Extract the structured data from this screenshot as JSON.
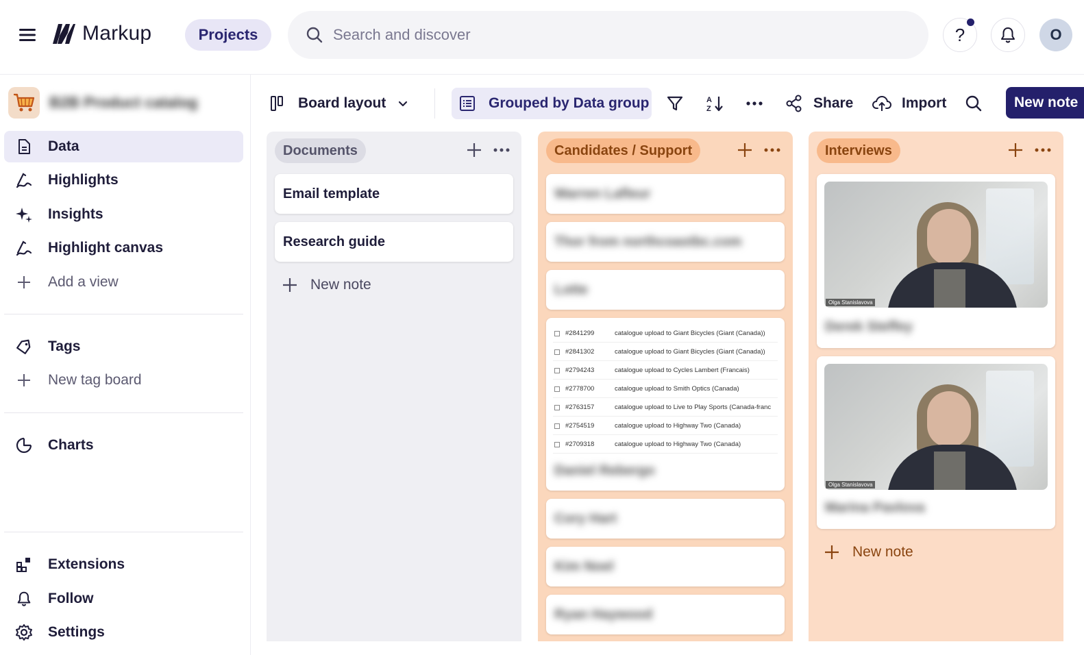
{
  "app": {
    "name": "Markup"
  },
  "topbar": {
    "projects_label": "Projects",
    "search_placeholder": "Search and discover",
    "help_label": "?",
    "avatar_initial": "O"
  },
  "sidebar": {
    "project_name": "B2B Product catalog",
    "items": [
      {
        "label": "Data",
        "icon": "document-icon"
      },
      {
        "label": "Highlights",
        "icon": "highlight-icon"
      },
      {
        "label": "Insights",
        "icon": "sparkle-icon"
      },
      {
        "label": "Highlight canvas",
        "icon": "highlight-icon"
      },
      {
        "label": "Add a view",
        "icon": "plus-icon"
      },
      {
        "label": "Tags",
        "icon": "tag-icon"
      },
      {
        "label": "New tag board",
        "icon": "plus-icon"
      },
      {
        "label": "Charts",
        "icon": "pie-chart-icon"
      },
      {
        "label": "Extensions",
        "icon": "extensions-icon"
      },
      {
        "label": "Follow",
        "icon": "bell-icon"
      },
      {
        "label": "Settings",
        "icon": "gear-icon"
      }
    ]
  },
  "toolbar": {
    "layout_label": "Board layout",
    "group_label": "Grouped by Data group",
    "share_label": "Share",
    "import_label": "Import",
    "new_note_label": "New note"
  },
  "columns": [
    {
      "title": "Documents",
      "cards": [
        "Email template",
        "Research guide"
      ],
      "new_note_label": "New note"
    },
    {
      "title": "Candidates / Support",
      "cards": [
        "Warren Lafleur",
        "Thor from northcoastbc.com",
        "Lotte",
        "Daniel Rebergo",
        "Cory Hart",
        "Kim Noel",
        "Ryan Haywood"
      ],
      "table_rows": [
        {
          "id": "#2841299",
          "desc": "catalogue upload to Giant Bicycles (Giant (Canada))"
        },
        {
          "id": "#2841302",
          "desc": "catalogue upload to Giant Bicycles (Giant (Canada))"
        },
        {
          "id": "#2794243",
          "desc": "catalogue upload to Cycles Lambert (Francais)"
        },
        {
          "id": "#2778700",
          "desc": "catalogue upload to Smith Optics (Canada)"
        },
        {
          "id": "#2763157",
          "desc": "catalogue upload to Live to Play Sports (Canada-franc"
        },
        {
          "id": "#2754519",
          "desc": "catalogue upload to Highway Two (Canada)"
        },
        {
          "id": "#2709318",
          "desc": "catalogue upload to Highway Two (Canada)"
        }
      ]
    },
    {
      "title": "Interviews",
      "cards": [
        {
          "caption": "Olga Stanislavova",
          "name": "Derek Steffey"
        },
        {
          "caption": "Olga Stanislavova",
          "name": "Marina Pavlova"
        }
      ],
      "new_note_label": "New note"
    }
  ],
  "colors": {
    "accent": "#24206b",
    "active_bg": "#ebeaf7",
    "orange_column": "#fbd7bc",
    "orange_pill": "#f8b98b"
  }
}
